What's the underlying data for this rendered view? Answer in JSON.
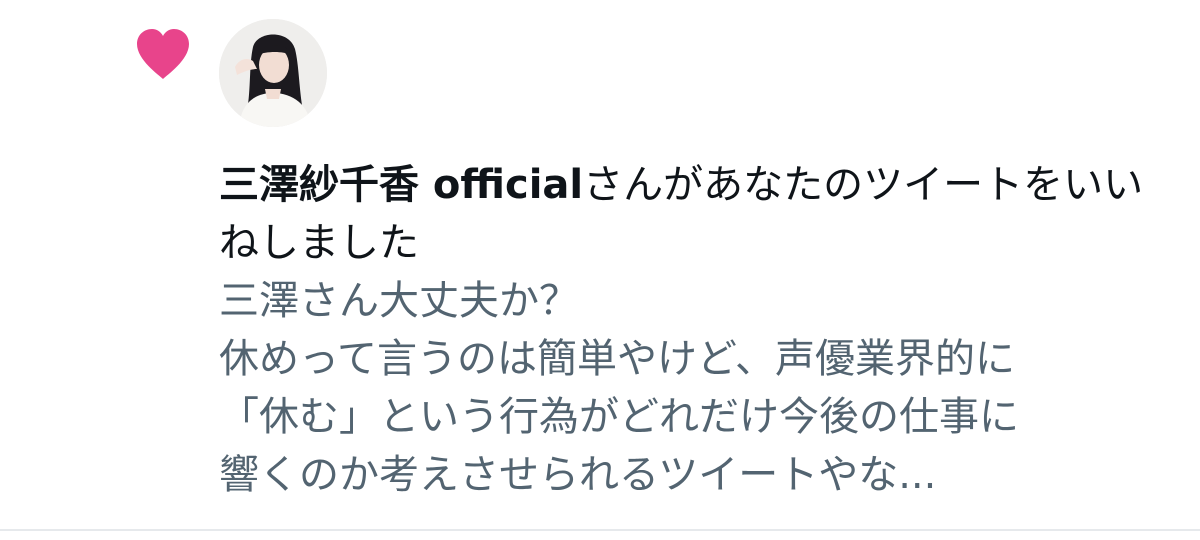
{
  "notification": {
    "type_icon": "heart-icon",
    "accent_color": "#e8448b",
    "avatar_icon": "user-avatar",
    "user_name": "三澤紗千香 official",
    "action_text": "さんがあなたのツイートをいいねしました",
    "tweet_lines": [
      "三澤さん大丈夫か？",
      "休めって言うのは簡単やけど、声優業界的に",
      "「休む」という行為がどれだけ今後の仕事に",
      "響くのか考えさせられるツイートやな..."
    ]
  }
}
